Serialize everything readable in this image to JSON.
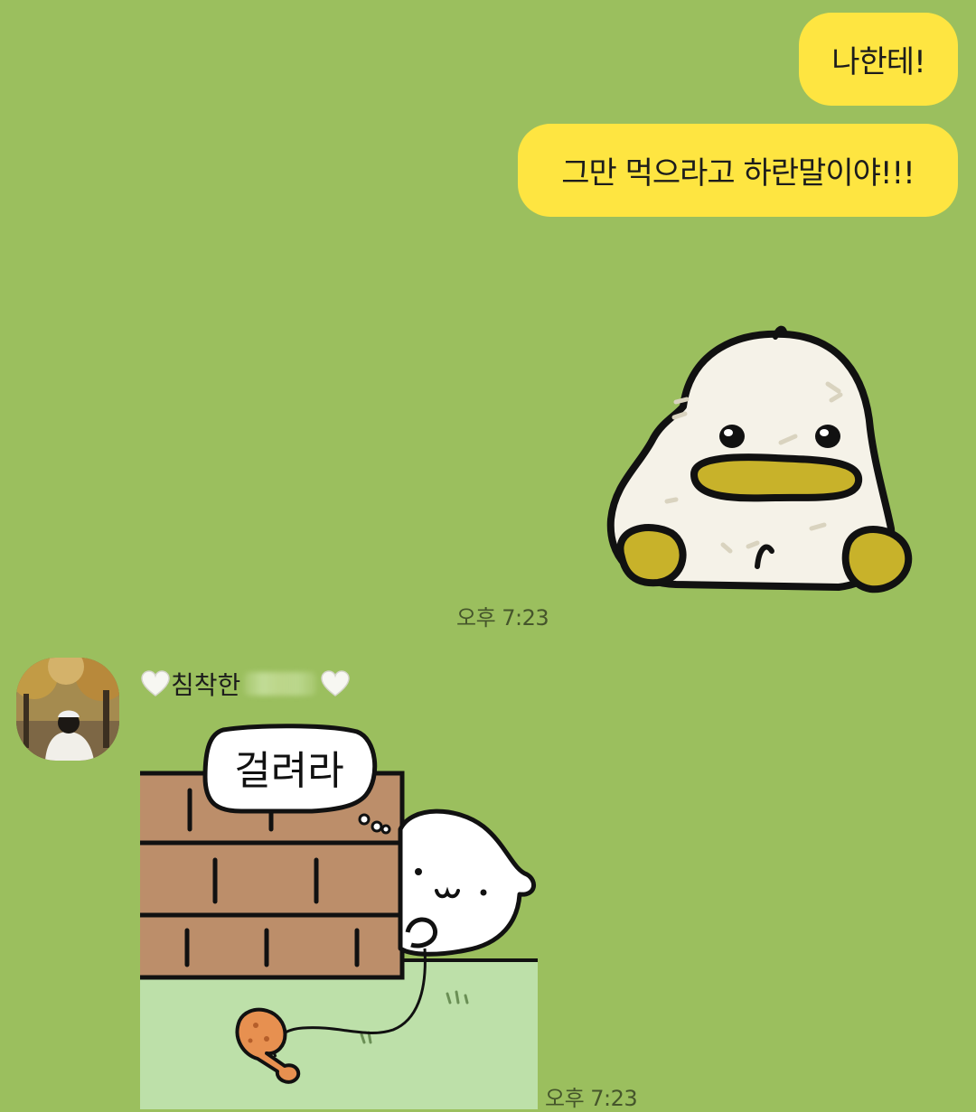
{
  "messages_out": [
    {
      "text": "나한테!"
    },
    {
      "text": "그만 먹으라고 하란말이야!!!"
    }
  ],
  "outgoing_timestamp": "오후 7:23",
  "incoming": {
    "sender_name_prefix": "침착한",
    "sticker_text": "걸려라",
    "timestamp": "오후 7:23"
  },
  "colors": {
    "chat_background": "#9bbf5e",
    "my_bubble": "#fee541",
    "timestamp_text": "#45552b"
  },
  "icons": {
    "sender_name_left": "white-heart-icon",
    "sender_name_right": "white-heart-icon"
  }
}
